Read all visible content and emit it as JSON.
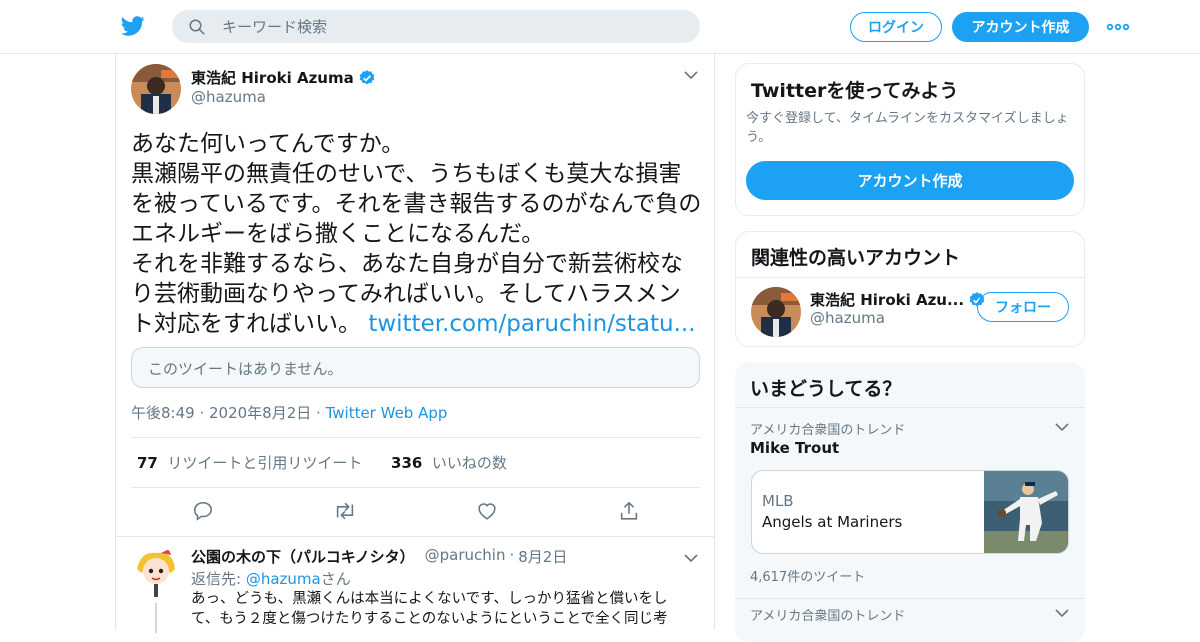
{
  "header": {
    "search_placeholder": "キーワード検索",
    "login_label": "ログイン",
    "signup_label": "アカウント作成"
  },
  "tweet": {
    "author_name": "東浩紀 Hiroki Azuma",
    "author_handle": "@hazuma",
    "text": "あなた何いってんですか。\n黒瀬陽平の無責任のせいで、うちもぼくも莫大な損害を被っているです。それを書き報告するのがなんで負のエネルギーをばら撒くことになるんだ。\nそれを非難するなら、あなた自身が自分で新芸術校なり芸術動画なりやってみればいい。そしてハラスメント対応をすればいい。 ",
    "link": "twitter.com/paruchin/statu...",
    "quote_unavailable": "このツイートはありません。",
    "time": "午後8:49",
    "date": "2020年8月2日",
    "source": "Twitter Web App",
    "retweets_count": "77",
    "retweets_label": "リツイートと引用リツイート",
    "likes_count": "336",
    "likes_label": "いいねの数"
  },
  "reply": {
    "author_name": "公園の木の下（パルコキノシタ）",
    "author_handle": "@paruchin",
    "date": "8月2日",
    "reply_to_prefix": "返信先: ",
    "reply_to_handle": "@hazuma",
    "reply_to_suffix": "さん",
    "text": "あっ、どうも、黒瀬くんは本当によくないです、しっかり猛省と償いをして、もう２度と傷つけたりすることのないようにということで全く同じ考"
  },
  "sidebar": {
    "signup_card": {
      "title": "Twitterを使ってみよう",
      "subtitle": "今すぐ登録して、タイムラインをカスタマイズしましょう。",
      "button": "アカウント作成"
    },
    "related": {
      "title": "関連性の高いアカウント",
      "name": "東浩紀 Hiroki Azu...",
      "handle": "@hazuma",
      "follow_label": "フォロー"
    },
    "trends": {
      "title": "いまどうしてる？",
      "items": [
        {
          "context": "アメリカ合衆国のトレンド",
          "name": "Mike Trout"
        },
        {
          "context": "アメリカ合衆国のトレンド",
          "name": ""
        }
      ],
      "card_category": "MLB",
      "card_title": "Angels at Mariners",
      "tweet_count": "4,617件のツイート"
    }
  },
  "colors": {
    "accent": "#1da1f2",
    "link": "#1b95e0",
    "muted": "#657786",
    "text": "#14171a"
  },
  "icons": [
    "twitter-bird-icon",
    "search-icon",
    "more-dots-icon",
    "verified-badge-icon",
    "chevron-down-icon",
    "reply-icon",
    "retweet-icon",
    "like-icon",
    "share-icon"
  ]
}
